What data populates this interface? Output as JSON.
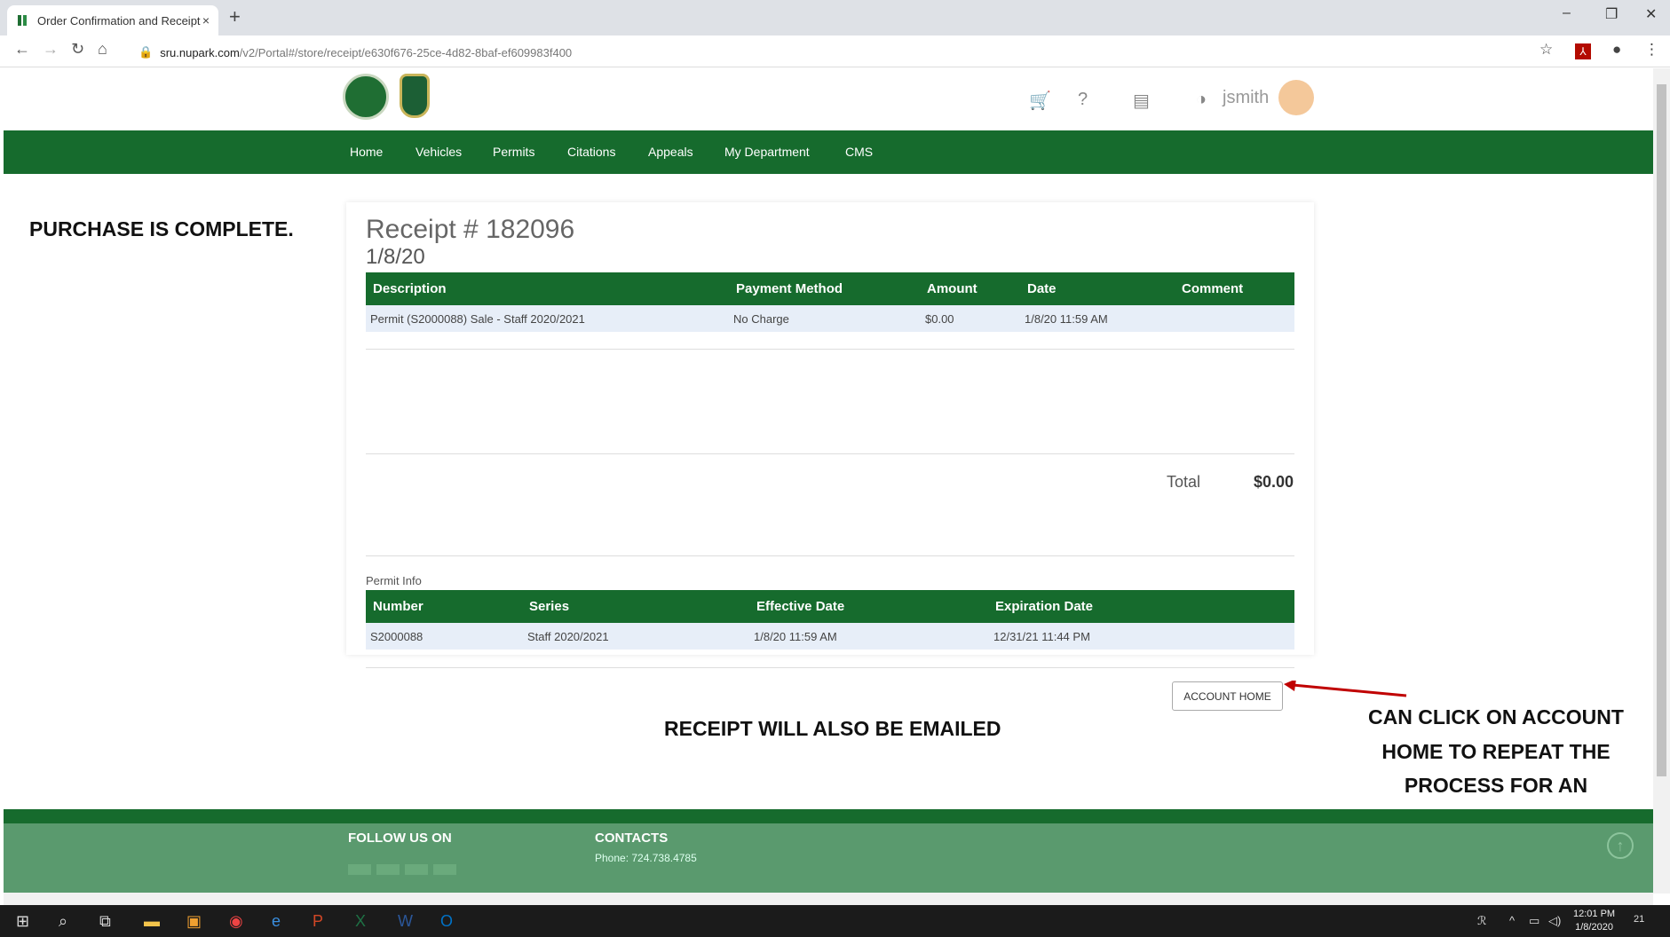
{
  "browser": {
    "tab_title": "Order Confirmation and Receipt",
    "tab_close": "×",
    "new_tab": "+",
    "url_host": "sru.nupark.com",
    "url_path": "/v2/Portal#/store/receipt/e630f676-25ce-4d82-8baf-ef609983f400"
  },
  "header": {
    "username": "jsmith"
  },
  "nav": {
    "items": [
      "Home",
      "Vehicles",
      "Permits",
      "Citations",
      "Appeals",
      "My Department",
      "CMS"
    ]
  },
  "annotation": {
    "purchase_complete": "PURCHASE IS COMPLETE.",
    "receipt_emailed": "RECEIPT WILL ALSO BE EMAILED",
    "account_home_note": "CAN CLICK ON ACCOUNT HOME TO REPEAT THE PROCESS FOR AN ADDITIONAL VEHICLE"
  },
  "receipt": {
    "title": "Receipt # 182096",
    "date": "1/8/20",
    "columns": [
      "Description",
      "Payment Method",
      "Amount",
      "Date",
      "Comment"
    ],
    "row": {
      "description": "Permit (S2000088) Sale - Staff 2020/2021",
      "payment_method": "No Charge",
      "amount": "$0.00",
      "date": "1/8/20 11:59 AM",
      "comment": ""
    },
    "total_label": "Total",
    "total_value": "$0.00",
    "permit_info_label": "Permit Info",
    "permit_columns": [
      "Number",
      "Series",
      "Effective Date",
      "Expiration Date"
    ],
    "permit_row": {
      "number": "S2000088",
      "series": "Staff 2020/2021",
      "effective": "1/8/20 11:59 AM",
      "expiration": "12/31/21 11:44 PM"
    },
    "account_home_button": "ACCOUNT HOME"
  },
  "footer": {
    "follow": "FOLLOW US ON",
    "contacts": "CONTACTS",
    "phone": "Phone: 724.738.4785"
  },
  "taskbar": {
    "time": "12:01 PM",
    "date": "1/8/2020",
    "notifications": "21"
  },
  "colors": {
    "brand_green": "#166b2d",
    "footer_green": "#5a9a6e",
    "row_tint": "#e7eef8",
    "arrow_red": "#c00000"
  }
}
